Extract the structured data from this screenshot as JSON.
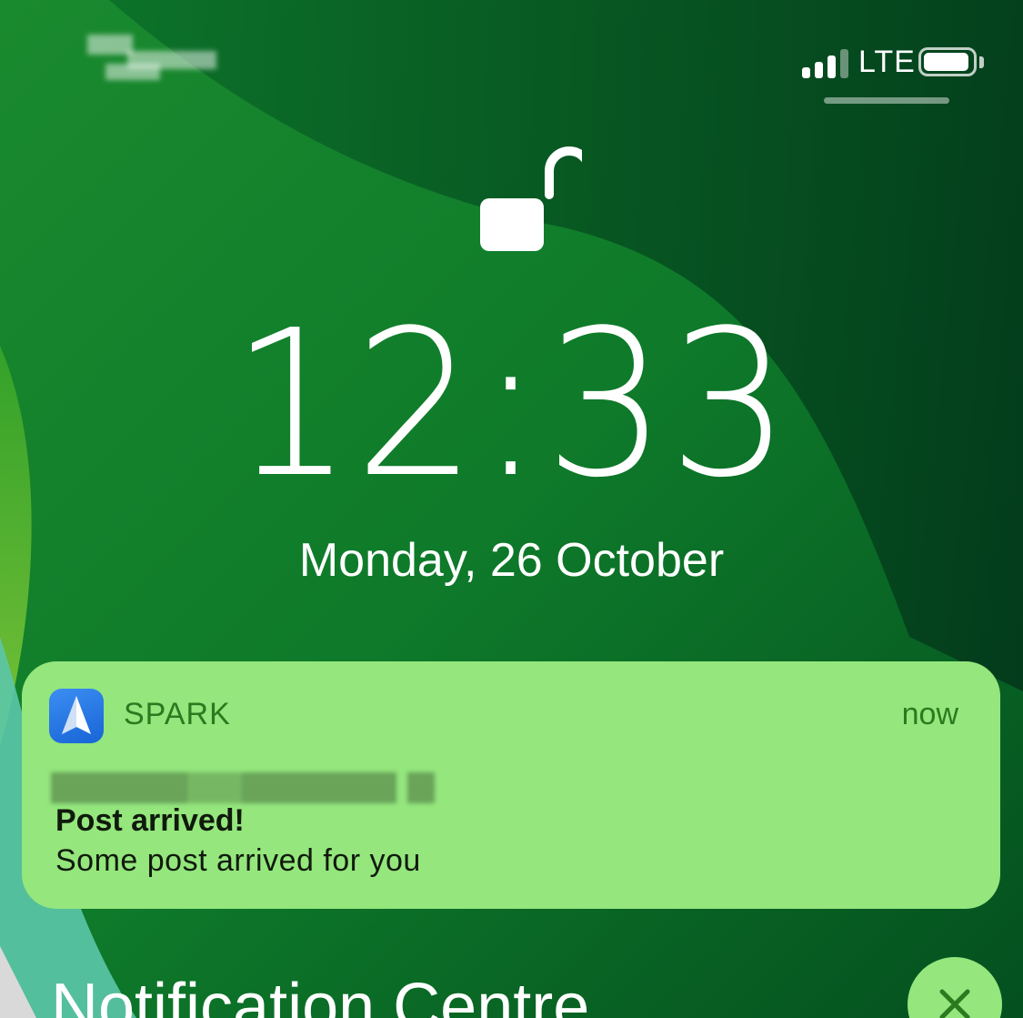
{
  "status_bar": {
    "network": "LTE",
    "signal_bars_active": 3,
    "signal_bars_total": 4,
    "battery_level": 0.95
  },
  "lock_screen": {
    "time": "12:33",
    "date": "Monday, 26 October"
  },
  "notification": {
    "app_name": "SPARK",
    "time": "now",
    "title": "Post arrived!",
    "body": "Some post arrived for you"
  },
  "notification_centre": {
    "title": "Notification Centre"
  },
  "colors": {
    "notification_bg": "#94e67d",
    "app_text": "#2b7a1f",
    "wallpaper_green": "#0c7a2c"
  },
  "icons": {
    "lock": "unlocked-padlock-icon",
    "app": "spark-paper-plane-icon",
    "clear": "close-icon"
  }
}
